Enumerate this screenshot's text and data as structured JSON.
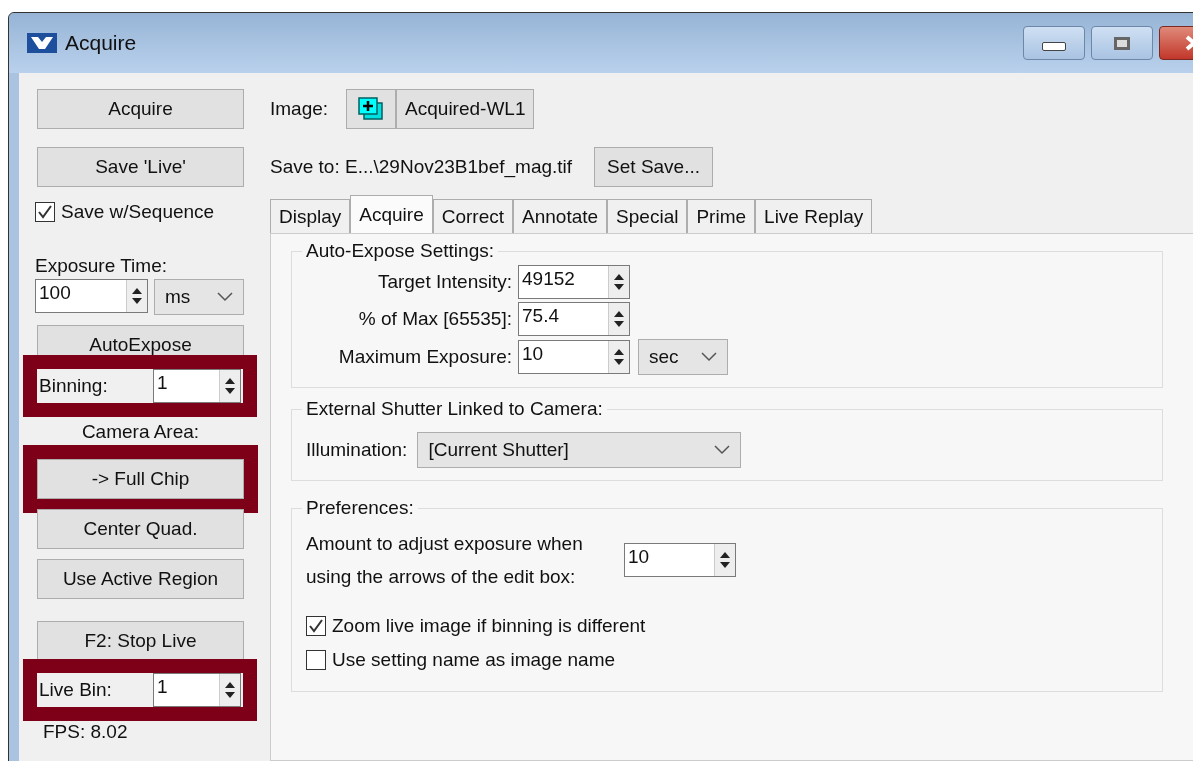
{
  "window": {
    "title": "Acquire"
  },
  "left_panel": {
    "acquire_button": "Acquire",
    "save_live_button": "Save 'Live'",
    "save_with_sequence": {
      "label": "Save w/Sequence",
      "checked": true
    },
    "exposure_time": {
      "label": "Exposure Time:",
      "value": "100",
      "unit": "ms"
    },
    "autoexpose_button": "AutoExpose",
    "binning": {
      "label": "Binning:",
      "value": "1",
      "highlighted": true
    },
    "camera_area_label": "Camera Area:",
    "camera_area_buttons": [
      {
        "label": "-> Full Chip",
        "highlighted": true
      },
      {
        "label": "Center Quad.",
        "highlighted": false
      },
      {
        "label": "Use Active Region",
        "highlighted": false
      }
    ],
    "stop_live_button": "F2: Stop Live",
    "live_bin": {
      "label": "Live Bin:",
      "value": "1",
      "highlighted": true
    },
    "fps": "FPS: 8.02"
  },
  "image": {
    "label": "Image:",
    "name": "Acquired-WL1"
  },
  "save_to": {
    "text": "Save to: E...\\29Nov23B1bef_mag.tif",
    "button": "Set Save..."
  },
  "tabs": [
    {
      "label": "Display",
      "selected": false
    },
    {
      "label": "Acquire",
      "selected": true
    },
    {
      "label": "Correct",
      "selected": false
    },
    {
      "label": "Annotate",
      "selected": false
    },
    {
      "label": "Special",
      "selected": false
    },
    {
      "label": "Prime",
      "selected": false
    },
    {
      "label": "Live Replay",
      "selected": false
    }
  ],
  "auto_expose_settings": {
    "title": "Auto-Expose Settings:",
    "fields": [
      {
        "label": "Target Intensity:",
        "value": "49152"
      },
      {
        "label": "% of Max [65535]:",
        "value": "75.4"
      },
      {
        "label": "Maximum Exposure:",
        "value": "10",
        "unit": "sec"
      }
    ]
  },
  "external_shutter": {
    "title": "External Shutter Linked to Camera:",
    "illumination": {
      "label": "Illumination:",
      "value": "[Current Shutter]"
    }
  },
  "preferences": {
    "title": "Preferences:",
    "adjust": {
      "label": "Amount to adjust exposure when using the arrows of the edit box:",
      "value": "10"
    },
    "options": [
      {
        "label": "Zoom live image if binning is different",
        "checked": true
      },
      {
        "label": "Use setting name as image name",
        "checked": false
      }
    ]
  }
}
